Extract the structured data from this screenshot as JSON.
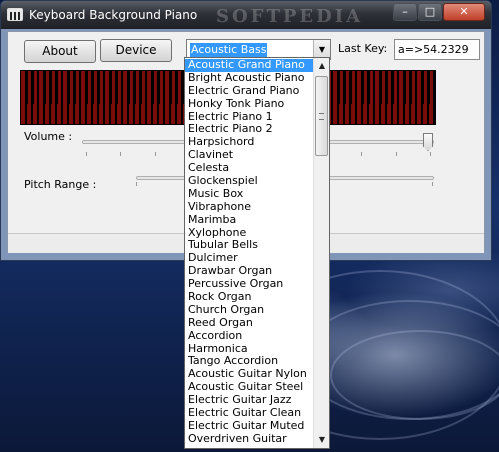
{
  "window": {
    "title": "Keyboard Background Piano",
    "watermark": "SOFTPEDIA",
    "controls": {
      "minimize": "–",
      "maximize": "□",
      "close": "✕"
    }
  },
  "toolbar": {
    "about_label": "About",
    "device_label": "Device",
    "instrument_selected": "Acoustic Bass",
    "last_key_label": "Last Key:",
    "last_key_value": "a=>54.2329"
  },
  "controls": {
    "volume_label": "Volume :",
    "volume_level": 1.0,
    "pitch_range_label": "Pitch Range :"
  },
  "keyboard": {
    "white_key_color": "#7a0c0c",
    "black_key_color": "#000000"
  },
  "instrument_list": {
    "items": [
      "Acoustic Grand Piano",
      "Bright Acoustic Piano",
      "Electric Grand Piano",
      "Honky Tonk Piano",
      "Electric Piano 1",
      "Electric Piano 2",
      "Harpsichord",
      "Clavinet",
      "Celesta",
      "Glockenspiel",
      "Music Box",
      "Vibraphone",
      "Marimba",
      "Xylophone",
      "Tubular Bells",
      "Dulcimer",
      "Drawbar Organ",
      "Percussive Organ",
      "Rock Organ",
      "Church Organ",
      "Reed Organ",
      "Accordion",
      "Harmonica",
      "Tango Accordion",
      "Acoustic Guitar Nylon",
      "Acoustic Guitar Steel",
      "Electric Guitar Jazz",
      "Electric Guitar Clean",
      "Electric Guitar Muted",
      "Overdriven Guitar"
    ],
    "highlighted_index": 0,
    "selection_color": "#3399ff"
  }
}
